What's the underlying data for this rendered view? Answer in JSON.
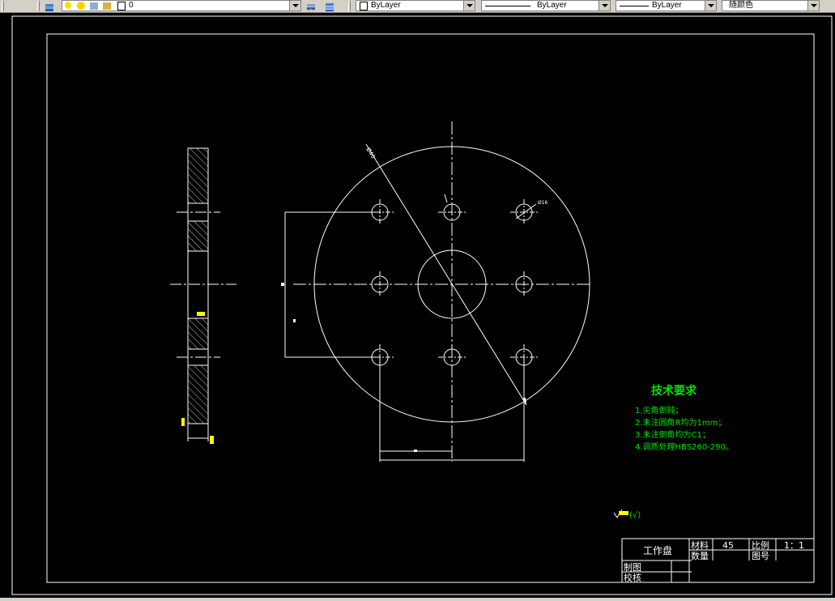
{
  "toolbar": {
    "layer_value": "0",
    "color_value": "ByLayer",
    "linetype_value": "ByLayer",
    "lineweight_value": "ByLayer",
    "plotstyle_value": "随颜色",
    "colors": {
      "chrome": "#d4d0c8",
      "bulb": "#ffe000"
    }
  },
  "drawing": {
    "background": "#000000",
    "line_color": "#ffffff",
    "tech_color": "#00e000",
    "dim_diameter": "Ø40",
    "dim_hole": "Ø16",
    "tech_title": "技术要求",
    "tech_notes": [
      "1.尖角倒钝；",
      "2.未注圆角R均为1mm；",
      "3.未注倒角均为C1；",
      "4.调质处理HBS260-290。"
    ],
    "roughness_note": "(√)",
    "title_block": {
      "part_name": "工作盘",
      "material_label": "材料",
      "material_value": "45",
      "scale_label": "比例",
      "scale_value": "1：1",
      "quantity_label": "数量",
      "drawing_no_label": "图号",
      "drawn_label": "制图",
      "checked_label": "校核"
    }
  }
}
